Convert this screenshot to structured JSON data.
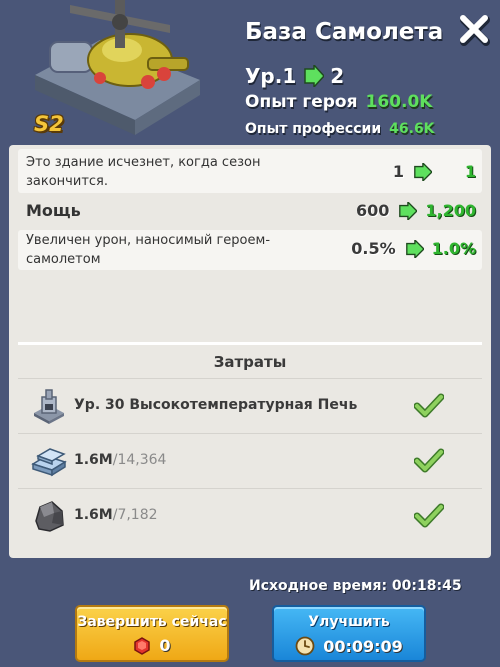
{
  "header": {
    "title": "База Самолета",
    "season_badge": "S2",
    "level_label_from": "Ур.1",
    "level_to": "2",
    "hero_xp_label": "Опыт героя",
    "hero_xp_value": "160.0K",
    "prof_xp_label": "Опыт профессии",
    "prof_xp_value": "46.6K"
  },
  "stats": [
    {
      "text": "Это здание исчезнет, когда сезон закончится.",
      "old": "1",
      "new": "1"
    },
    {
      "text": "Мощь",
      "old": "600",
      "new": "1,200"
    },
    {
      "text": "Увеличен урон, наносимый героем-самолетом",
      "old": "0.5%",
      "new": "1.0%"
    }
  ],
  "costs": {
    "title": "Затраты",
    "items": [
      {
        "icon": "furnace-icon",
        "name": "Ур. 30 Высокотемпературная Печь",
        "done": true
      },
      {
        "icon": "iron-ingot-icon",
        "have": "1.6M",
        "need": "/14,364",
        "done": true
      },
      {
        "icon": "ore-rock-icon",
        "have": "1.6M",
        "need": "/7,182",
        "done": true
      }
    ]
  },
  "footer": {
    "orig_time": "Исходное время: 00:18:45",
    "finish_label": "Завершить сейчас",
    "finish_cost": "0",
    "upgrade_label": "Улучшить",
    "upgrade_time": "00:09:09"
  },
  "colors": {
    "background": "#4a5678",
    "accent_green": "#5ee05e",
    "finish_button": "#f4bd2e",
    "upgrade_button": "#2a9be6"
  }
}
